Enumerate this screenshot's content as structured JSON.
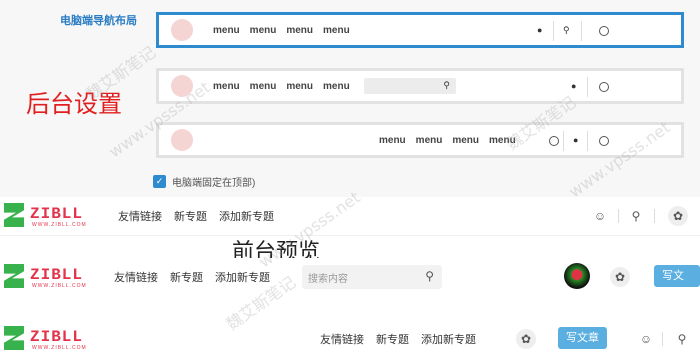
{
  "admin": {
    "section_label": "电脑端导航布局",
    "caption": "后台设置",
    "menu_items": [
      "menu",
      "menu",
      "menu",
      "menu"
    ],
    "checkbox_label": "电脑端固定在顶部)",
    "checkbox_checked": true
  },
  "front": {
    "caption": "前台预览",
    "logo_text": "ZIBLL",
    "logo_sub": "WWW.ZIBLL.COM",
    "nav_items": [
      "友情链接",
      "新专题",
      "添加新专题"
    ],
    "search_placeholder": "搜索内容",
    "write_button": "写文章"
  },
  "watermark": {
    "line1": "魏艾斯笔记",
    "line2": "www.vpsss.net"
  },
  "colors": {
    "accent_blue": "#2f8bd0",
    "logo_green": "#37b24d",
    "logo_red": "#e2334b",
    "caption_red": "#e02020",
    "write_button_bg": "#5aaee0"
  }
}
